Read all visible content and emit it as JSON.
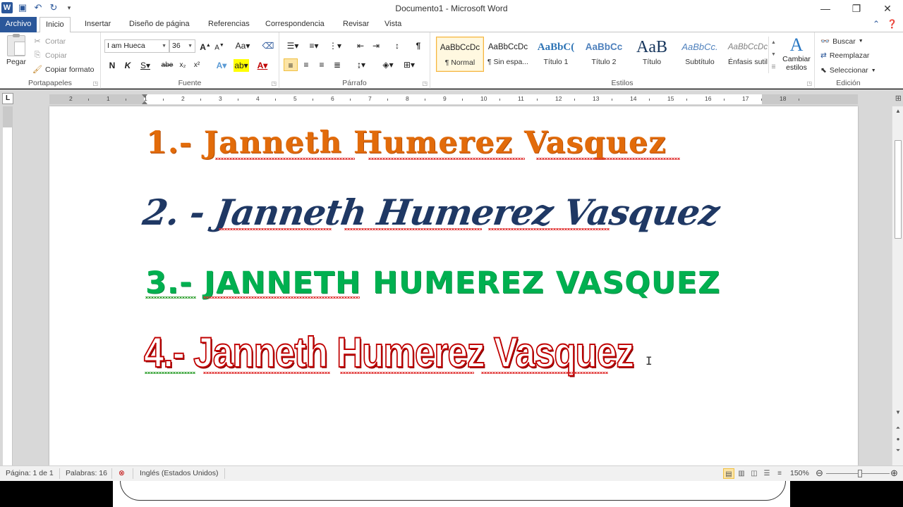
{
  "window": {
    "title": "Documento1  -  Microsoft Word",
    "controls": [
      "—",
      "❐",
      "✕"
    ]
  },
  "quick_access": {
    "logo": "W",
    "icons": [
      "save-icon",
      "undo-icon",
      "redo-icon",
      "customize-icon"
    ]
  },
  "tabs": [
    "Archivo",
    "Inicio",
    "Insertar",
    "Diseño de página",
    "Referencias",
    "Correspondencia",
    "Revisar",
    "Vista"
  ],
  "active_tab": "Inicio",
  "ribbon": {
    "clipboard": {
      "label": "Portapapeles",
      "paste": "Pegar",
      "cut": "Cortar",
      "copy": "Copiar",
      "format_painter": "Copiar formato"
    },
    "font": {
      "label": "Fuente",
      "font_name": "I am Hueca",
      "font_size": "36"
    },
    "paragraph": {
      "label": "Párrafo"
    },
    "styles": {
      "label": "Estilos",
      "items": [
        {
          "preview": "AaBbCcDc",
          "name": "¶ Normal"
        },
        {
          "preview": "AaBbCcDc",
          "name": "¶ Sin espa..."
        },
        {
          "preview": "AaBbC(",
          "name": "Título 1"
        },
        {
          "preview": "AaBbCc",
          "name": "Título 2"
        },
        {
          "preview": "AaB",
          "name": "Título"
        },
        {
          "preview": "AaBbCc.",
          "name": "Subtítulo"
        },
        {
          "preview": "AaBbCcDc",
          "name": "Énfasis sutil"
        }
      ],
      "change_styles": "Cambiar estilos"
    },
    "editing": {
      "label": "Edición",
      "find": "Buscar",
      "replace": "Reemplazar",
      "select": "Seleccionar"
    }
  },
  "ruler": {
    "numbers": [
      "2",
      "1",
      "1",
      "2",
      "3",
      "4",
      "5",
      "6",
      "7",
      "8",
      "9",
      "10",
      "11",
      "12",
      "13",
      "14",
      "15",
      "16",
      "17",
      "18"
    ]
  },
  "document": {
    "lines": [
      "1.-  Janneth Humerez Vasquez",
      "2. -  Janneth Humerez Vasquez",
      "3.- JANNETH HUMEREZ VASQUEZ",
      "4.- Janneth Humerez Vasquez"
    ]
  },
  "statusbar": {
    "page": "Página: 1 de 1",
    "words": "Palabras: 16",
    "language": "Inglés (Estados Unidos)",
    "zoom": "150%"
  },
  "colors": {
    "brand": "#2b579a",
    "line1": "#e26b0a",
    "line2": "#1f3864",
    "line3": "#00b050",
    "line4": "#c00000"
  }
}
